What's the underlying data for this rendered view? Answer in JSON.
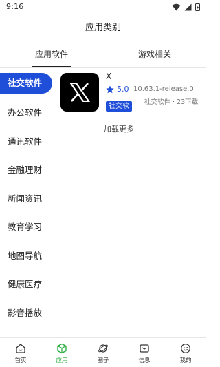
{
  "status": {
    "time": "9:16"
  },
  "title": "应用类别",
  "tabs": [
    {
      "label": "应用软件",
      "active": true
    },
    {
      "label": "游戏相关",
      "active": false
    }
  ],
  "sidebar": {
    "items": [
      {
        "label": "社交软件",
        "active": true
      },
      {
        "label": "办公软件",
        "active": false
      },
      {
        "label": "通讯软件",
        "active": false
      },
      {
        "label": "金融理财",
        "active": false
      },
      {
        "label": "新闻资讯",
        "active": false
      },
      {
        "label": "教育学习",
        "active": false
      },
      {
        "label": "地图导航",
        "active": false
      },
      {
        "label": "健康医疗",
        "active": false
      },
      {
        "label": "影音播放",
        "active": false
      }
    ]
  },
  "apps": [
    {
      "name": "X",
      "icon": "x-logo",
      "rating": "5.0",
      "version": "10.63.1-release.0",
      "category_badge": "社交软",
      "meta": "社交软件 · 23下载"
    }
  ],
  "load_more": "加载更多",
  "bottom_nav": [
    {
      "label": "首页",
      "icon": "home-icon",
      "active": false
    },
    {
      "label": "应用",
      "icon": "cube-icon",
      "active": true
    },
    {
      "label": "圈子",
      "icon": "planet-icon",
      "active": false
    },
    {
      "label": "信息",
      "icon": "message-icon",
      "active": false
    },
    {
      "label": "我的",
      "icon": "smiley-icon",
      "active": false
    }
  ],
  "colors": {
    "accent": "#1f4ed8",
    "nav_active": "#22a93a"
  }
}
